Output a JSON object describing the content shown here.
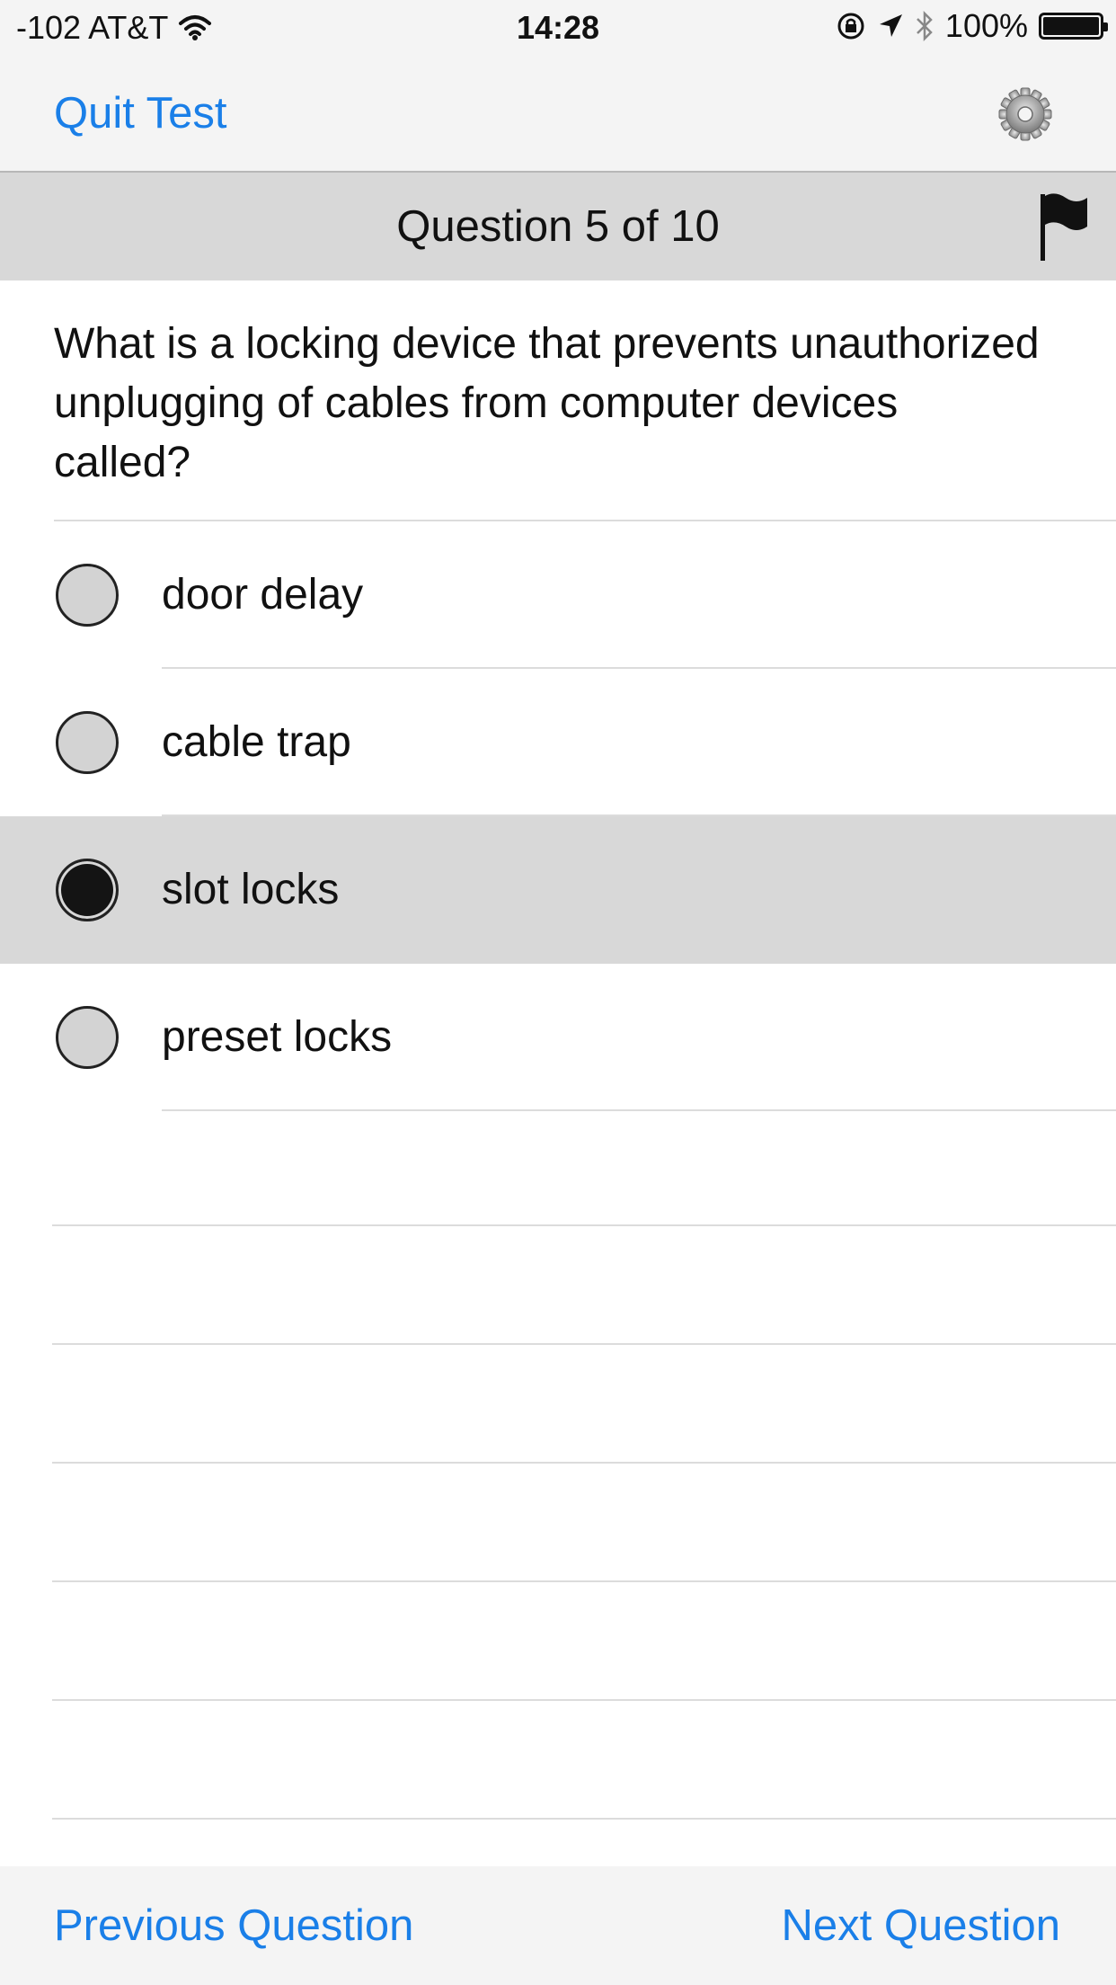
{
  "status_bar": {
    "carrier": "-102 AT&T",
    "time": "14:28",
    "battery": "100%",
    "icons": [
      "wifi-icon",
      "rotation-lock-icon",
      "location-icon",
      "bluetooth-icon",
      "battery-icon"
    ]
  },
  "nav": {
    "quit_label": "Quit Test",
    "settings_icon": "gear-icon"
  },
  "question": {
    "header": "Question 5 of 10",
    "flag_icon": "flag-icon",
    "text": "What is a locking device that prevents unauthorized unplugging of cables from computer devices called?"
  },
  "answers": [
    {
      "label": "door delay",
      "selected": false
    },
    {
      "label": "cable trap",
      "selected": false
    },
    {
      "label": "slot locks",
      "selected": true
    },
    {
      "label": "preset locks",
      "selected": false
    }
  ],
  "footer": {
    "previous_label": "Previous Question",
    "next_label": "Next Question"
  },
  "colors": {
    "accent": "#1a7fe8",
    "header_bg": "#d8d8d8",
    "bar_bg": "#f4f4f4",
    "selected_bg": "#d8d8d8"
  }
}
